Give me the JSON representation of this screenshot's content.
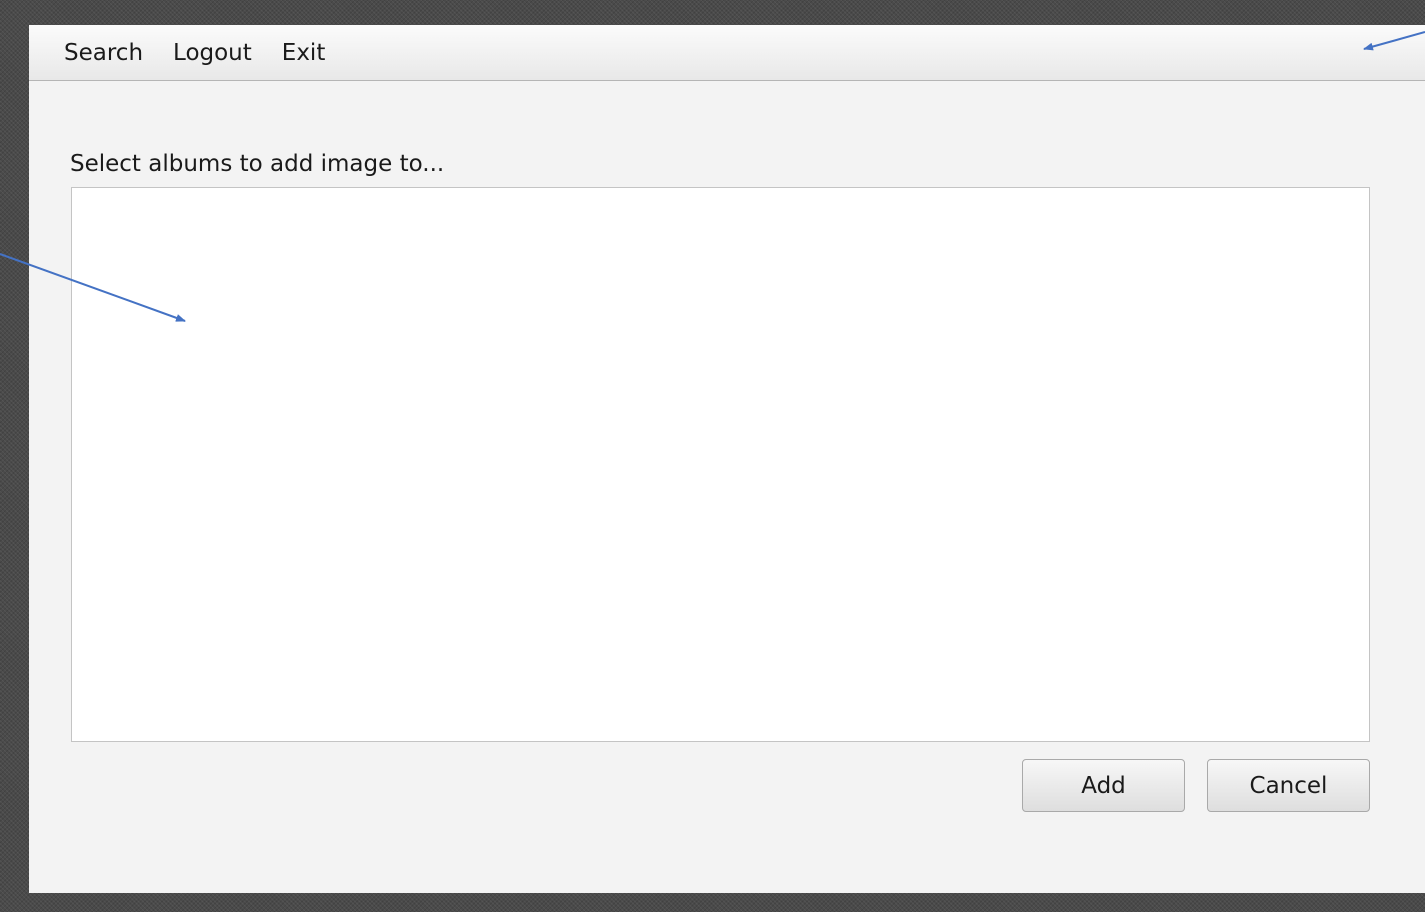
{
  "menubar": {
    "items": [
      {
        "label": "Search"
      },
      {
        "label": "Logout"
      },
      {
        "label": "Exit"
      }
    ]
  },
  "dialog": {
    "prompt": "Select albums to add image to...",
    "add_label": "Add",
    "cancel_label": "Cancel"
  },
  "colors": {
    "window_bg": "#f3f3f3",
    "list_bg": "#ffffff",
    "annotation_arrow": "#4472c4"
  }
}
